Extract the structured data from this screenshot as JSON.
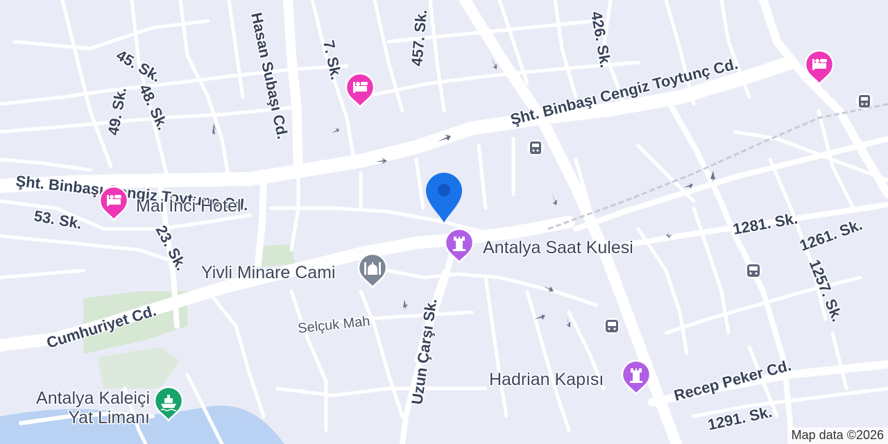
{
  "map": {
    "streets": {
      "sht_binbasi_west": "Şht. Binbaşı Cengiz Toytunç Cd.",
      "sht_binbasi_east": "Şht. Binbaşı Cengiz Toytunç Cd.",
      "hasan_subasi": "Hasan Subaşı Cd.",
      "sk_7": "7. Sk.",
      "sk_457": "457. Sk.",
      "sk_426": "426. Sk.",
      "sk_45": "45. Sk.",
      "sk_48": "48. Sk.",
      "sk_49": "49. Sk.",
      "sk_53": "53. Sk.",
      "sk_23": "23. Sk.",
      "cumhuriyet": "Cumhuriyet Cd.",
      "uzun_carsi": "Uzun Çarşı Sk.",
      "recep_peker": "Recep Peker Cd.",
      "sk_1281": "1281. Sk.",
      "sk_1261": "1261. Sk.",
      "sk_1257": "1257. Sk.",
      "sk_1291": "1291. Sk."
    },
    "neighborhoods": {
      "selcuk": "Selçuk Mah"
    },
    "pois": {
      "mai_inci": {
        "label": "Mai İnci Hotel",
        "icon": "hotel-icon",
        "color": "#ee37b6"
      },
      "hotel_north": {
        "label": "",
        "icon": "hotel-icon",
        "color": "#ee37b6"
      },
      "saat_kulesi": {
        "label": "Antalya Saat Kulesi",
        "icon": "tower-icon",
        "color": "#b15ee6"
      },
      "yivli_minare": {
        "label": "Yivli Minare Cami",
        "icon": "mosque-icon",
        "color": "#7d8696"
      },
      "hadrian": {
        "label": "Hadrian Kapısı",
        "icon": "tower-icon",
        "color": "#b15ee6"
      },
      "kaleici_marina": {
        "label_line1": "Antalya Kaleiçi",
        "label_line2": "Yat Limanı",
        "icon": "ferry-icon",
        "color": "#17a36b"
      }
    },
    "transit_icons": [
      "tram-icon",
      "tram-icon",
      "bus-icon",
      "bus-icon"
    ],
    "location_pin": {
      "icon": "location-pin-icon",
      "color": "#1a73e8"
    },
    "attribution": "Map data ©2026",
    "colors": {
      "land": "#e9ecf6",
      "water": "#b9d1f2",
      "park": "#d2e6cf",
      "road": "#ffffff"
    }
  }
}
